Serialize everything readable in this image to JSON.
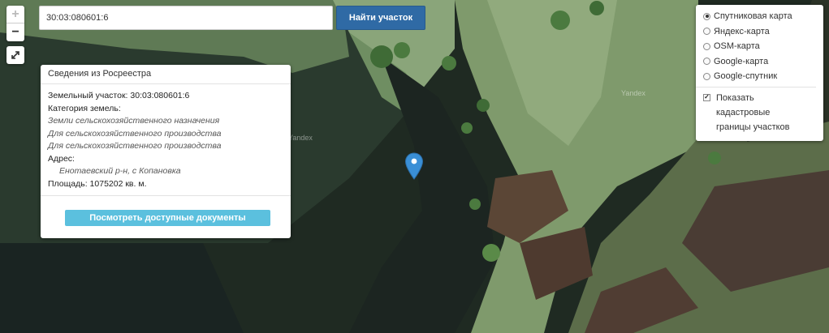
{
  "search": {
    "value": "30:03:080601:6",
    "button_label": "Найти участок"
  },
  "zoom": {
    "in": "+",
    "out": "−"
  },
  "info_panel": {
    "title": "Сведения из Росреестра",
    "parcel_label": "Земельный участок:",
    "parcel_value": "30:03:080601:6",
    "category_label": "Категория земель:",
    "categories": [
      "Земли сельскохозяйственного назначения",
      "Для сельскохозяйственного производства",
      "Для сельскохозяйственного производства"
    ],
    "address_label": "Адрес:",
    "address_value": "Енотаевский р-н, с Копановка",
    "area_label": "Площадь:",
    "area_value": "1075202 кв. м.",
    "docs_button": "Посмотреть доступные документы"
  },
  "layers": {
    "options": [
      {
        "label": "Спутниковая карта",
        "selected": true
      },
      {
        "label": "Яндекс-карта",
        "selected": false
      },
      {
        "label": "OSM-карта",
        "selected": false
      },
      {
        "label": "Google-карта",
        "selected": false
      },
      {
        "label": "Google-спутник",
        "selected": false
      }
    ],
    "cadastral_label_line1": "Показать",
    "cadastral_label_line2": "кадастровые",
    "cadastral_label_line3": "границы участков",
    "cadastral_checked": true
  },
  "map": {
    "watermark_1": "Yandex",
    "watermark_2": "Yandex",
    "marker_color": "#3a8fd6"
  }
}
